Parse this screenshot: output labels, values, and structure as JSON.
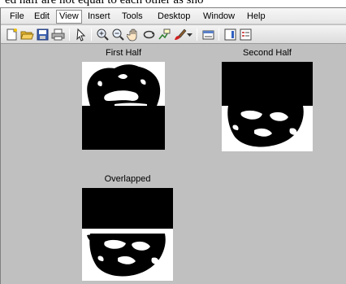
{
  "page_text": "ed half are not equal to each other as sho",
  "menu": {
    "items": [
      {
        "label": "File"
      },
      {
        "label": "Edit"
      },
      {
        "label": "View"
      },
      {
        "label": "Insert"
      },
      {
        "label": "Tools"
      },
      {
        "label": "Desktop"
      },
      {
        "label": "Window"
      },
      {
        "label": "Help"
      }
    ],
    "active_label": "View"
  },
  "toolbar": {
    "icons": [
      "new-figure-icon",
      "open-file-icon",
      "save-icon",
      "print-icon",
      "pointer-icon",
      "zoom-in-icon",
      "zoom-out-icon",
      "pan-icon",
      "rotate-3d-icon",
      "data-cursor-icon",
      "brush-icon",
      "dropdown-arrow-icon",
      "link-plot-icon",
      "colorbar-icon",
      "legend-icon"
    ]
  },
  "plots": {
    "first": {
      "title": "First Half"
    },
    "second": {
      "title": "Second Half"
    },
    "overlapped": {
      "title": "Overlapped"
    }
  },
  "colors": {
    "window_bg": "#c0c0c0",
    "image_black": "#000000",
    "image_white": "#ffffff"
  }
}
